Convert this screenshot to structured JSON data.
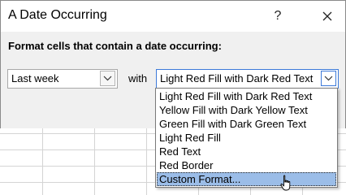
{
  "dialog": {
    "title": "A Date Occurring",
    "help_label": "?",
    "prompt": "Format cells that contain a date occurring:",
    "period_value": "Last week",
    "with_label": "with",
    "format_value": "Light Red Fill with Dark Red Text"
  },
  "format_options": [
    "Light Red Fill with Dark Red Text",
    "Yellow Fill with Dark Yellow Text",
    "Green Fill with Dark Green Text",
    "Light Red Fill",
    "Red Text",
    "Red Border",
    "Custom Format..."
  ],
  "highlighted_option": "Custom Format...",
  "colors": {
    "dialog_bg": "#f0f0f0",
    "focus_border": "#3d7ad9",
    "highlight": "#9bbde8"
  },
  "icons": {
    "close": "close-icon",
    "dropdown": "chevron-down-icon",
    "pointer": "hand-cursor-icon"
  }
}
